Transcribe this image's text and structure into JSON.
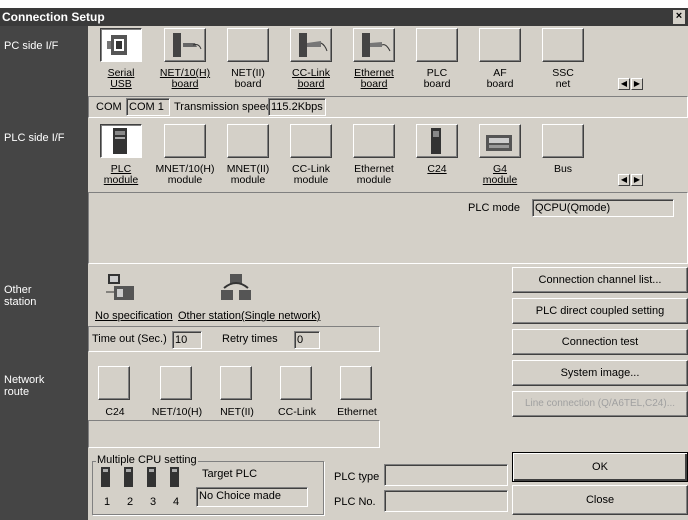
{
  "window": {
    "title": "Connection Setup",
    "close": "×"
  },
  "left_labels": {
    "pc_side": "PC side I/F",
    "plc_side": "PLC side I/F",
    "other_station": "Other station",
    "network_route": "Network route"
  },
  "pc_side": {
    "items": [
      {
        "line1": "Serial",
        "line2": "USB",
        "underline": true
      },
      {
        "line1": "NET/10(H)",
        "line2": "board",
        "underline": true
      },
      {
        "line1": "NET(II)",
        "line2": "board",
        "underline": false
      },
      {
        "line1": "CC-Link",
        "line2": "board",
        "underline": true
      },
      {
        "line1": "Ethernet",
        "line2": "board",
        "underline": true
      },
      {
        "line1": "PLC",
        "line2": "board",
        "underline": false
      },
      {
        "line1": "AF",
        "line2": "board",
        "underline": false
      },
      {
        "line1": "SSC",
        "line2": "net",
        "underline": false
      }
    ],
    "com_label": "COM",
    "com_value": "COM 1",
    "speed_label": "Transmission speed",
    "speed_value": "115.2Kbps"
  },
  "plc_side": {
    "items": [
      {
        "line1": "PLC",
        "line2": "module",
        "underline": true
      },
      {
        "line1": "MNET/10(H)",
        "line2": "module",
        "underline": false
      },
      {
        "line1": "MNET(II)",
        "line2": "module",
        "underline": false
      },
      {
        "line1": "CC-Link",
        "line2": "module",
        "underline": false
      },
      {
        "line1": "Ethernet",
        "line2": "module",
        "underline": false
      },
      {
        "line1": "C24",
        "line2": "",
        "underline": true
      },
      {
        "line1": "G4",
        "line2": "module",
        "underline": true
      },
      {
        "line1": "Bus",
        "line2": "",
        "underline": false
      }
    ],
    "plc_mode_label": "PLC mode",
    "plc_mode_value": "QCPU(Qmode)"
  },
  "other_station": {
    "no_spec": "No specification",
    "single_network": "Other station(Single network)",
    "timeout_label": "Time out (Sec.)",
    "timeout_value": "10",
    "retry_label": "Retry times",
    "retry_value": "0"
  },
  "network_route": {
    "items": [
      "C24",
      "NET/10(H)",
      "NET(II)",
      "CC-Link",
      "Ethernet"
    ]
  },
  "multi_cpu": {
    "title": "Multiple CPU setting",
    "target_label": "Target PLC",
    "target_value": "No Choice made",
    "cpu_numbers": [
      "1",
      "2",
      "3",
      "4"
    ],
    "plc_type_label": "PLC type",
    "plc_type_value": "",
    "plc_no_label": "PLC No.",
    "plc_no_value": ""
  },
  "right_buttons": {
    "channel_list": "Connection channel list...",
    "direct_coupled": "PLC direct coupled setting",
    "test": "Connection test",
    "system_image": "System image...",
    "line_connection": "Line connection (Q/A6TEL,C24)...",
    "ok": "OK",
    "close": "Close"
  }
}
